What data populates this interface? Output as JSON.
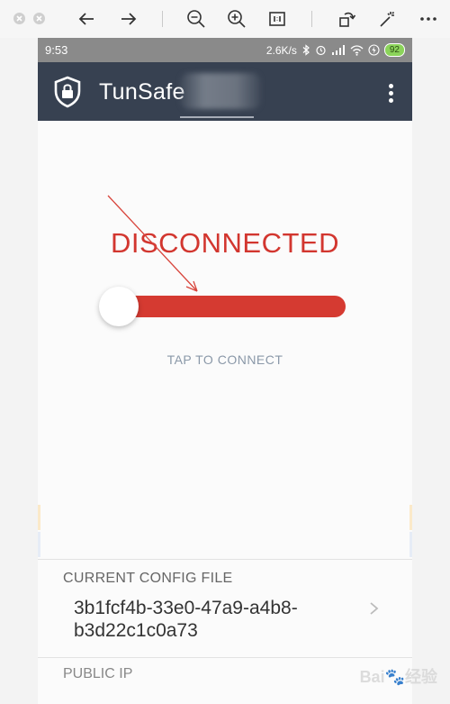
{
  "status_bar": {
    "time": "9:53",
    "speed": "2.6K/s",
    "battery": "92"
  },
  "app": {
    "title": "TunSafe"
  },
  "main": {
    "status_title": "DISCONNECTED",
    "hint": "TAP TO CONNECT"
  },
  "config": {
    "label": "CURRENT CONFIG FILE",
    "value": "3b1fcf4b-33e0-47a9-a4b8-b3d22c1c0a73"
  },
  "public_ip": {
    "label": "PUBLIC IP"
  },
  "colors": {
    "accent": "#d53a31",
    "appbar": "#374151",
    "hint": "#8a98a8"
  },
  "icons": [
    "close-icon",
    "minimize-icon",
    "back-icon",
    "forward-icon",
    "zoom-out-icon",
    "zoom-in-icon",
    "actual-size-icon",
    "rotate-icon",
    "magic-icon",
    "more-icon",
    "shield-lock-icon",
    "overflow-menu-icon",
    "chevron-right-icon"
  ]
}
